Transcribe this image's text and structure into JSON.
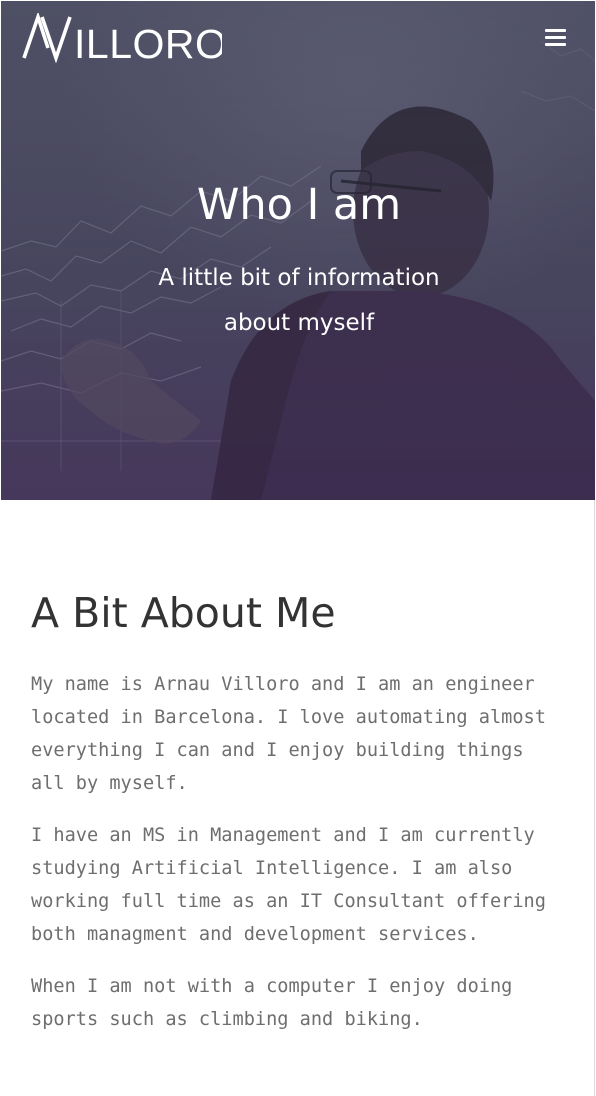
{
  "header": {
    "logo_text": "AVILLORO",
    "menu_icon": "hamburger-menu-icon"
  },
  "hero": {
    "title": "Who I am",
    "subtitle": "A little bit of information about myself",
    "background_image": "man-drawing-charts-on-glass"
  },
  "about": {
    "heading": "A Bit About Me",
    "paragraphs": [
      "My name is Arnau Villoro and I am an engineer located in Barcelona. I love automating almost everything I can and I enjoy building things all by myself.",
      "I have an MS in Management and I am currently studying Artificial Intelligence. I am also working full time as an IT Consultant offering both managment and development services.",
      "When I am not with a computer I enjoy doing sports such as climbing and biking."
    ]
  },
  "colors": {
    "hero_overlay": "#4e4a63",
    "heading_text": "#333333",
    "body_text": "#6e6e6e",
    "white": "#ffffff"
  }
}
